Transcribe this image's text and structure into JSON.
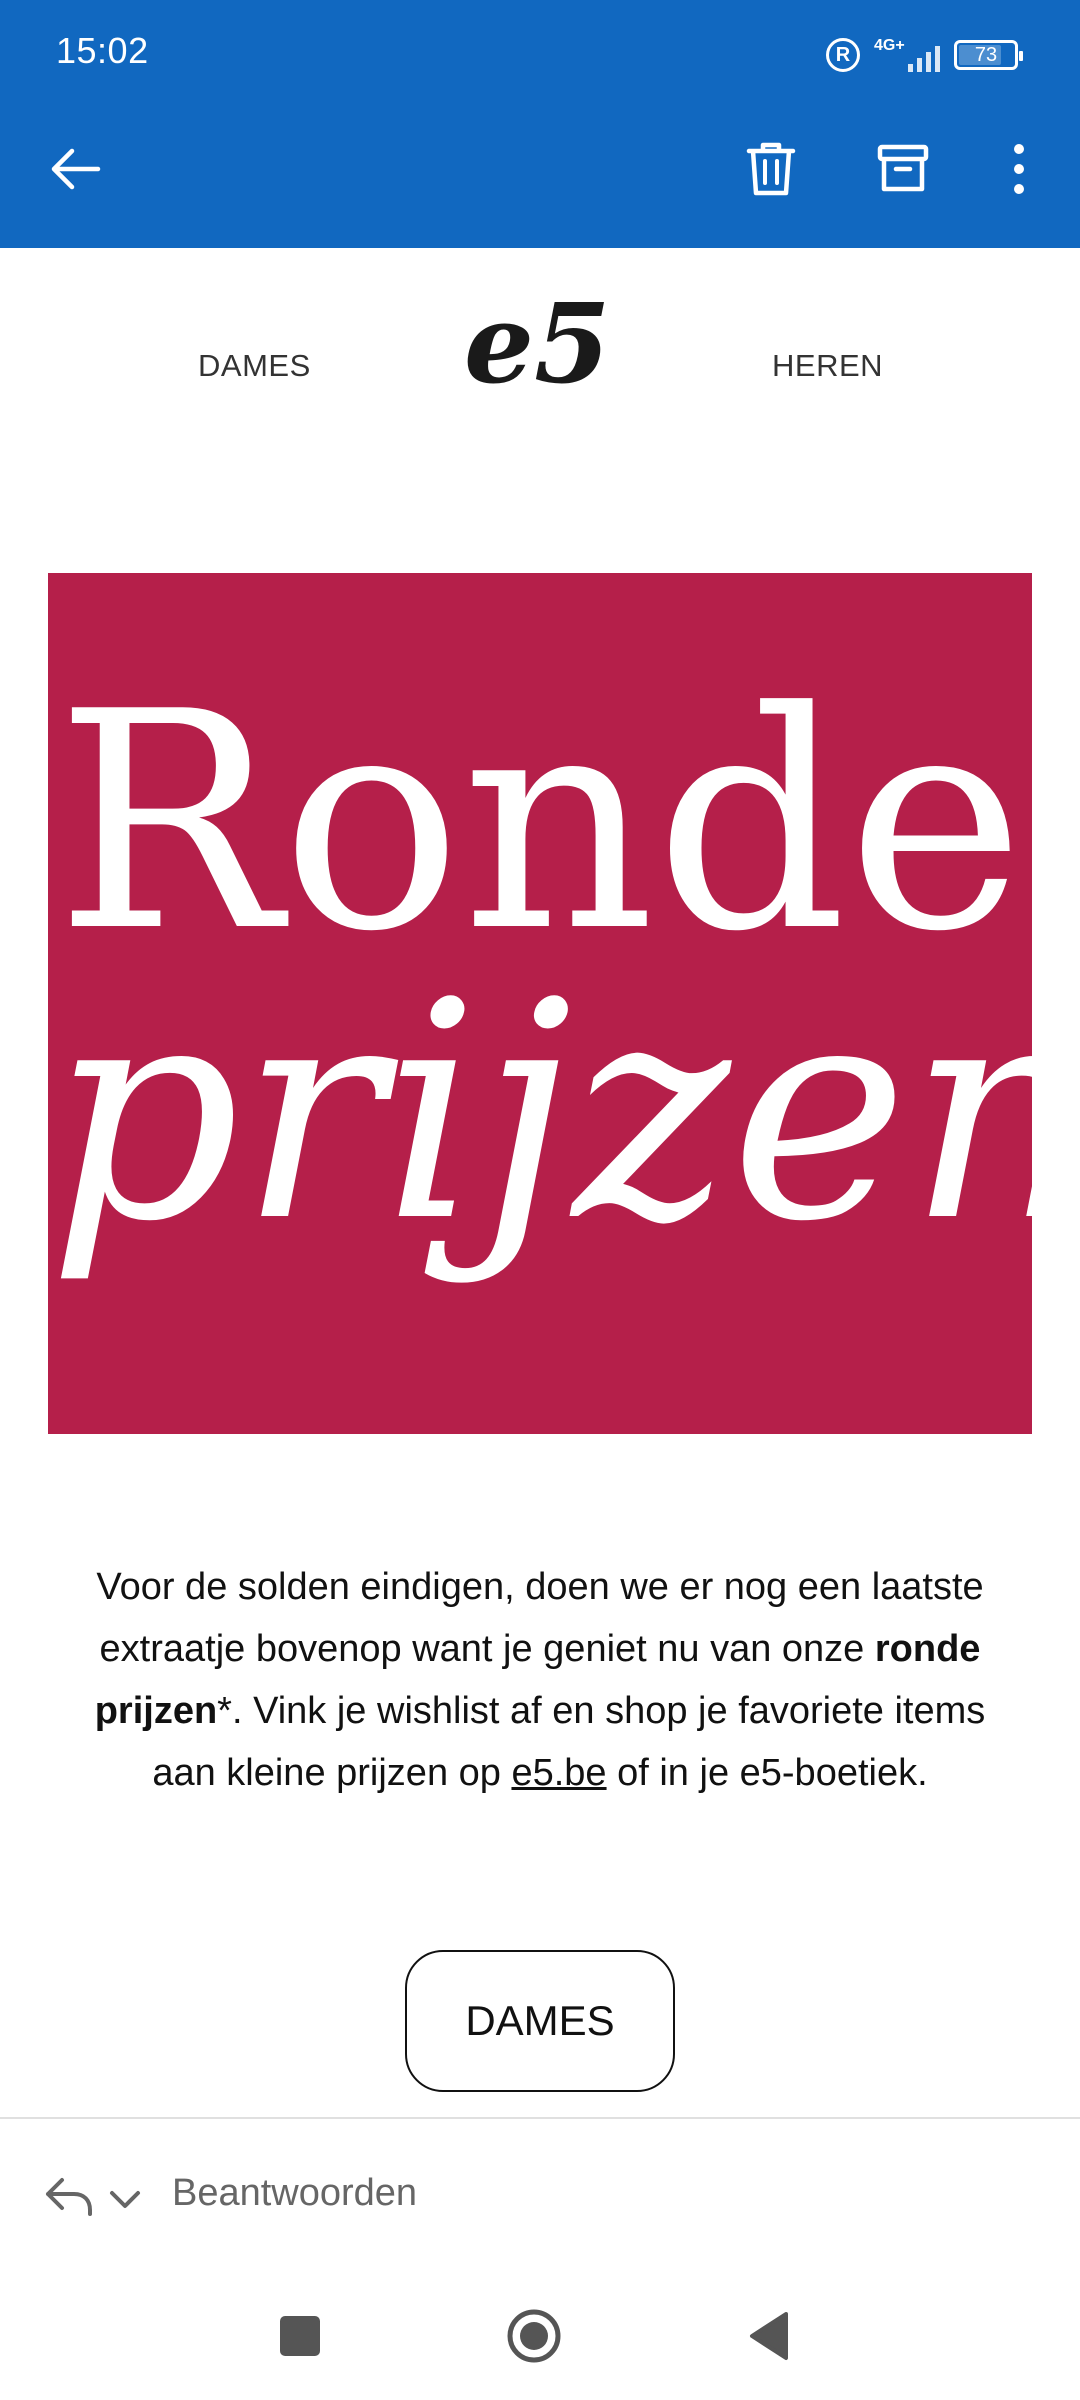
{
  "status_bar": {
    "time": "15:02",
    "network": "4G+",
    "battery": "73"
  },
  "app_bar": {
    "icons": [
      "back-arrow-icon",
      "trash-icon",
      "archive-icon",
      "more-vert-icon"
    ]
  },
  "email": {
    "nav_left": "DAMES",
    "nav_right": "HEREN",
    "logo_text": "e5",
    "hero": {
      "line1": "Ronde",
      "line2": "prijzen",
      "background": "#b51f4a"
    },
    "body": {
      "part1": "Voor de solden eindigen, doen we er nog een laatste extraatje bovenop want je geniet nu van onze ",
      "bold": "ronde prijzen",
      "part2": "*. Vink je wishlist af en shop je favoriete items aan kleine prijzen op ",
      "link": "e5.be",
      "part3": " of in je e5-boetiek."
    },
    "cta_label": "DAMES"
  },
  "reply_bar": {
    "label": "Beantwoorden"
  },
  "colors": {
    "app_bar": "#1168c0",
    "accent": "#b51f4a"
  }
}
